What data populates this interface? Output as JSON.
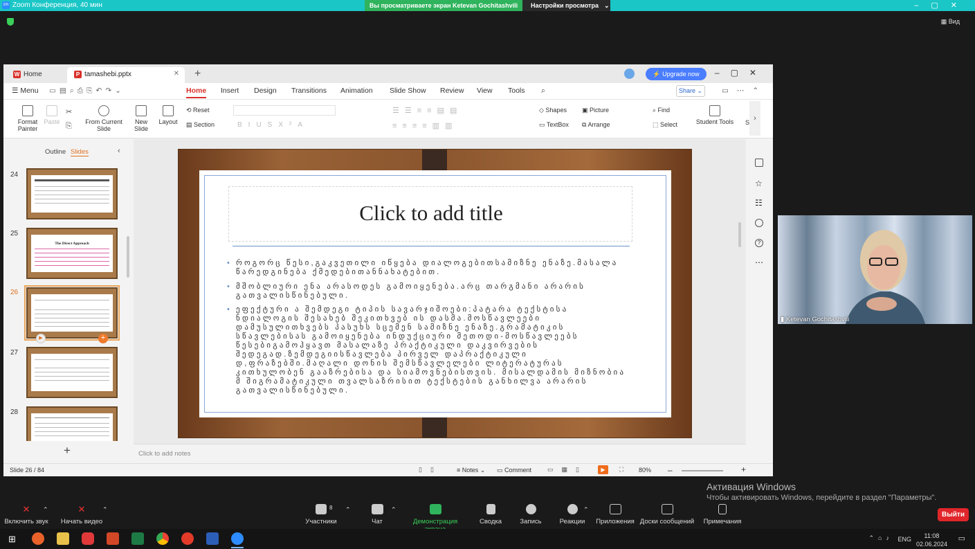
{
  "zoom": {
    "app_title": "Zoom Конференция, 40 мин",
    "share_banner": "Вы просматриваете экран Ketevan Gochitashvili",
    "view_options": "Настройки просмотра",
    "view_label": "Вид",
    "participant_name": "Ketevan Gochitashvili",
    "participants_count": "8",
    "toolbar": [
      {
        "label": "Включить звук",
        "icon": "mic-muted-icon"
      },
      {
        "label": "Начать видео",
        "icon": "video-off-icon"
      },
      {
        "label": "Участники",
        "icon": "participants-icon"
      },
      {
        "label": "Чат",
        "icon": "chat-icon"
      },
      {
        "label": "Демонстрация экрана",
        "icon": "share-screen-icon",
        "color": "#2fb35c"
      },
      {
        "label": "Сводка",
        "icon": "summary-icon"
      },
      {
        "label": "Запись",
        "icon": "record-icon"
      },
      {
        "label": "Реакции",
        "icon": "reactions-icon"
      },
      {
        "label": "Приложения",
        "icon": "apps-icon"
      },
      {
        "label": "Доски сообщений",
        "icon": "whiteboard-icon"
      },
      {
        "label": "Примечания",
        "icon": "notes-icon"
      }
    ],
    "leave": "Выйти"
  },
  "wps": {
    "home_tab": "Home",
    "doc_tab": "tamashebi.pptx",
    "upgrade": "Upgrade now",
    "menu_label": "Menu",
    "menu_tabs": [
      "Home",
      "Insert",
      "Design",
      "Transitions",
      "Animation",
      "Slide Show",
      "Review",
      "View",
      "Tools"
    ],
    "share": "Share",
    "ribbon": {
      "format_painter": "Format Painter",
      "paste": "Paste",
      "from_current_slide": "From Current Slide",
      "new_slide": "New Slide",
      "layout": "Layout",
      "reset": "Reset",
      "section": "Section",
      "shapes": "Shapes",
      "picture": "Picture",
      "textbox": "TextBox",
      "arrange": "Arrange",
      "find": "Find",
      "select": "Select",
      "student_tools": "Student Tools",
      "cut_off": "Se"
    },
    "panel": {
      "outline": "Outline",
      "slides": "Slides"
    },
    "thumb_numbers": [
      "24",
      "25",
      "26",
      "27",
      "28"
    ],
    "thumb25_heading": "The Direct Approach",
    "slide": {
      "title": "Click to add title",
      "bullets": [
        "როგორც წესი,გაკვეთილი იწყება დიალოგებითსამიზნე ენაზე.მასალა წარედგინება ქმედებითანნახატებით.",
        "მშობლიური ენა არასოდეს გამოიყენება.არც თარგმანი არარის გათვალისწინებული.",
        "ეფექტური ა შემდეგი ტიპის სავარჯიშოები:პატარა ტექსტისა ნდიალოგის შესახებ შეკითხვებ ის დასმა.მოსწავლეები დამუსულითხვებს პასუხს სცემენ სამიზნე ენაზე.გრამატიკის სწავლებისას გამოიყენება ინდუქციური მეთოდი-მოსწავლეებს წესებიგამოჰყავთ მასალაზე პრაქტიკული დაკვირვების შედეგად.ზემდეგიისწავლება პირველ დაპრაქტიკული დ,ფრაზებში.მაღალი დონის შემსწავლელები ლიტერატურას კითხულობენ გააზრებისა და სიამოვნებისთვის. მისალდამის მიზნობია მ შიგრამატიკული თვალსაზრისით ტექსტების განხილვა არარის გათვალისწინებული."
      ]
    },
    "notes_placeholder": "Click to add notes",
    "status": {
      "slide_pos": "Slide 26 / 84",
      "notes": "Notes",
      "comment": "Comment",
      "zoom": "80%"
    }
  },
  "windows": {
    "activate_title": "Активация Windows",
    "activate_text": "Чтобы активировать Windows, перейдите в раздел \"Параметры\".",
    "lang": "ENG",
    "time": "11:08",
    "date": "02.06.2024"
  }
}
